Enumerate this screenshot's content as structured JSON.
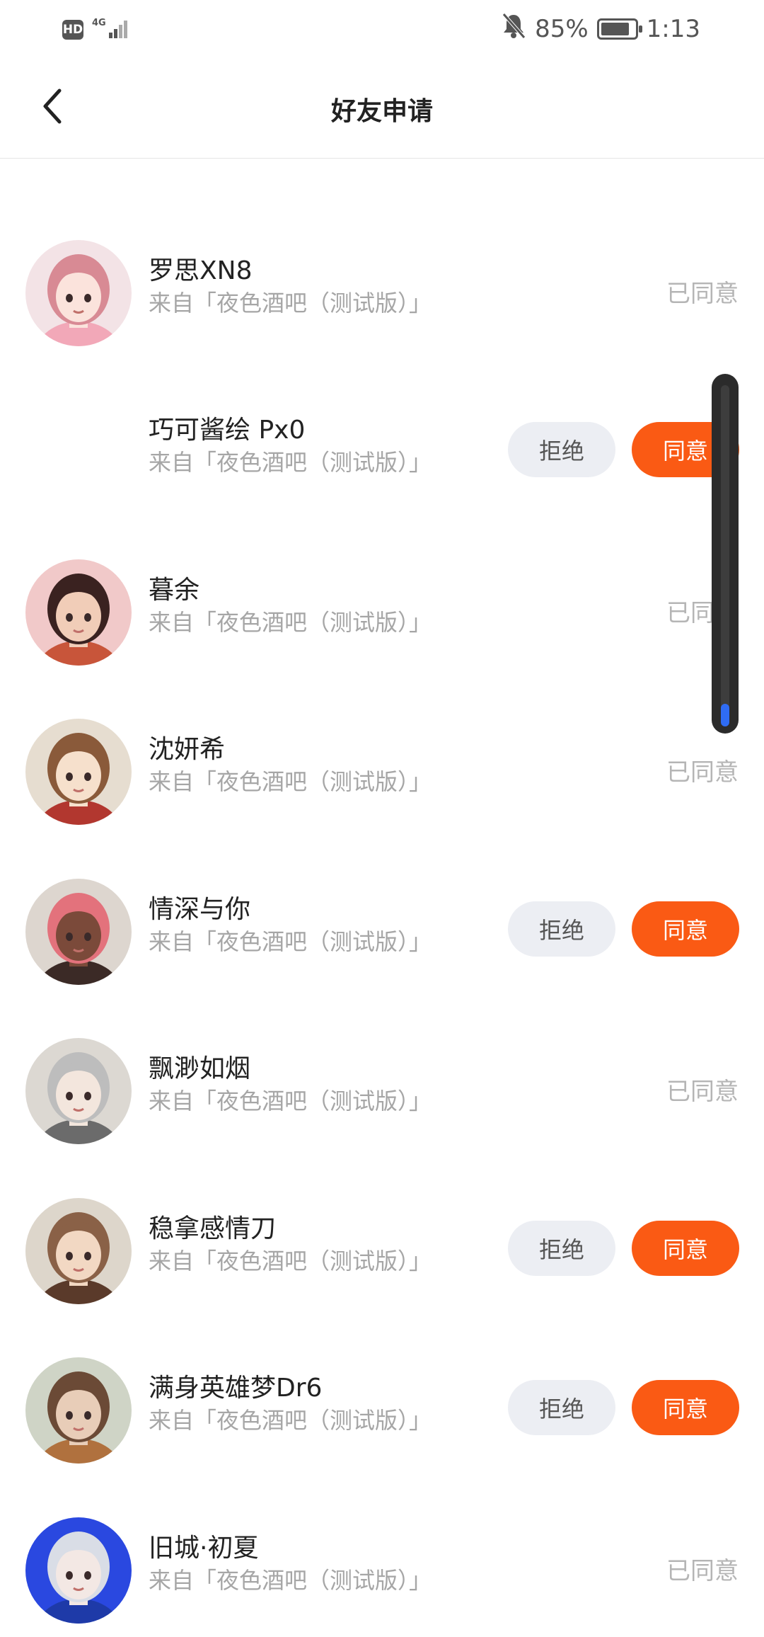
{
  "status_bar": {
    "hd": "HD",
    "network": "4G",
    "battery": "85%",
    "battery_level": 0.85,
    "time": "1:13",
    "icons": [
      "signal-icon",
      "bell-muted-icon",
      "battery-icon"
    ]
  },
  "header": {
    "title": "好友申请",
    "back_icon": "chevron-left-icon"
  },
  "buttons": {
    "reject": "拒绝",
    "accept": "同意",
    "agreed": "已同意"
  },
  "colors": {
    "accent": "#fa5a14",
    "reject_bg": "#eceef3",
    "muted_text": "#a6a6a6",
    "scroll_thumb": "#2f6cf4"
  },
  "requests": [
    {
      "name": "",
      "source": "来自「夜色酒吧（测试版）」",
      "status": "pending"
    },
    {
      "name": "罗思XN8",
      "source": "来自「夜色酒吧（测试版）」",
      "status": "agreed"
    },
    {
      "name": "巧可酱绘 Px0",
      "source": "来自「夜色酒吧（测试版）」",
      "status": "pending"
    },
    {
      "name": "暮余",
      "source": "来自「夜色酒吧（测试版）」",
      "status": "agreed"
    },
    {
      "name": "沈妍希",
      "source": "来自「夜色酒吧（测试版）」",
      "status": "agreed"
    },
    {
      "name": "情深与你",
      "source": "来自「夜色酒吧（测试版）」",
      "status": "pending"
    },
    {
      "name": "飘渺如烟",
      "source": "来自「夜色酒吧（测试版）」",
      "status": "agreed"
    },
    {
      "name": "稳拿感情刀",
      "source": "来自「夜色酒吧（测试版）」",
      "status": "pending"
    },
    {
      "name": "满身英雄梦Dr6",
      "source": "来自「夜色酒吧（测试版）」",
      "status": "pending"
    },
    {
      "name": "旧城·初夏",
      "source": "来自「夜色酒吧（测试版）」",
      "status": "agreed"
    }
  ]
}
